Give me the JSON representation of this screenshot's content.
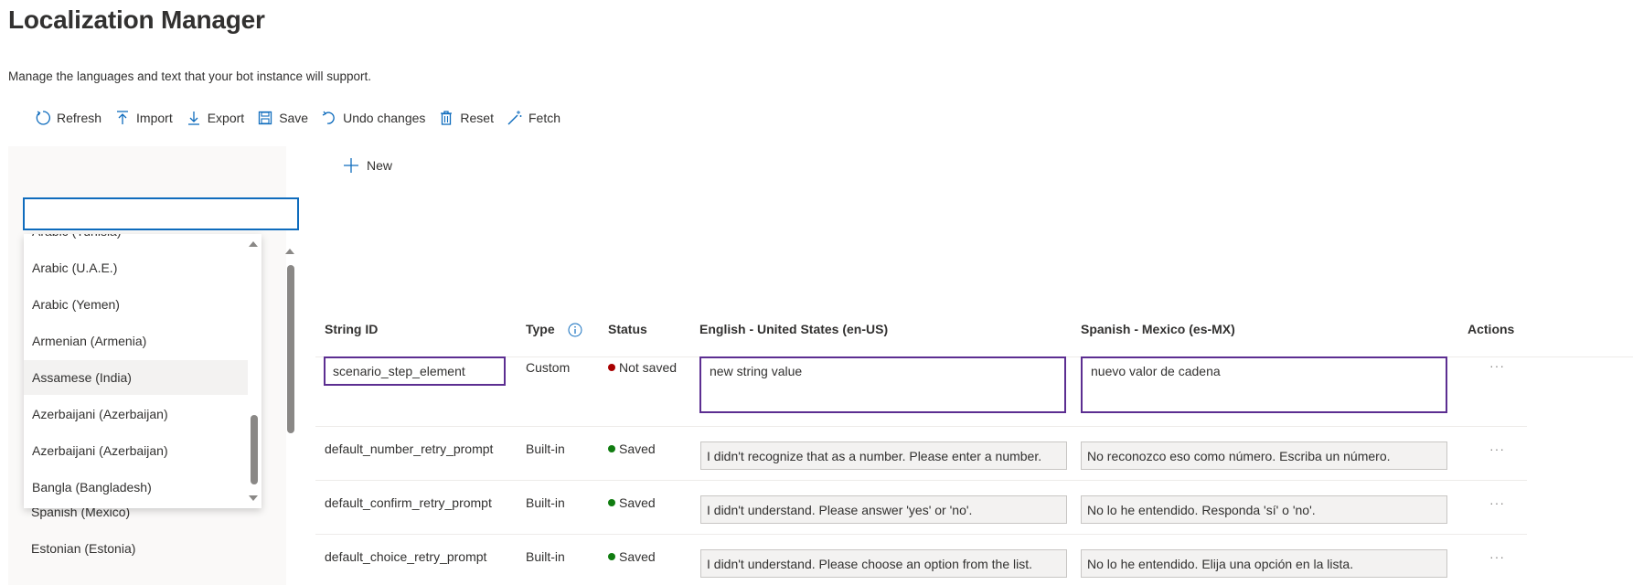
{
  "header": {
    "title": "Localization Manager",
    "subtitle": "Manage the languages and text that your bot instance will support."
  },
  "toolbar": {
    "refresh": "Refresh",
    "import": "Import",
    "export": "Export",
    "save": "Save",
    "undo": "Undo changes",
    "reset": "Reset",
    "fetch": "Fetch"
  },
  "sidebar": {
    "search_value": "",
    "dropdown_items": [
      "Arabic (Tunisia)",
      "Arabic (U.A.E.)",
      "Arabic (Yemen)",
      "Armenian (Armenia)",
      "Assamese (India)",
      "Azerbaijani (Azerbaijan)",
      "Azerbaijani (Azerbaijan)",
      "Bangla (Bangladesh)"
    ],
    "hovered_item": "Assamese (India)",
    "languages": [
      "Spanish (Mexico)",
      "Estonian (Estonia)"
    ]
  },
  "main": {
    "new_label": "New",
    "columns": {
      "string_id": "String ID",
      "type": "Type",
      "status": "Status",
      "english": "English - United States (en-US)",
      "spanish": "Spanish - Mexico (es-MX)",
      "actions": "Actions"
    },
    "rows": [
      {
        "id": "scenario_step_element",
        "type": "Custom",
        "status": "Not saved",
        "english": "new string value",
        "spanish": "nuevo valor de cadena",
        "actions": "···"
      },
      {
        "id": "default_number_retry_prompt",
        "type": "Built-in",
        "status": "Saved",
        "english": "I didn't recognize that as a number. Please enter a number.",
        "spanish": "No reconozco eso como número. Escriba un número.",
        "actions": "···"
      },
      {
        "id": "default_confirm_retry_prompt",
        "type": "Built-in",
        "status": "Saved",
        "english": "I didn't understand. Please answer 'yes' or 'no'.",
        "spanish": "No lo he entendido. Responda 'sí' o 'no'.",
        "actions": "···"
      },
      {
        "id": "default_choice_retry_prompt",
        "type": "Built-in",
        "status": "Saved",
        "english": "I didn't understand. Please choose an option from the list.",
        "spanish": "No lo he entendido. Elija una opción en la lista.",
        "actions": "···"
      }
    ]
  },
  "colors": {
    "accent": "#0f6cbd",
    "edit_border": "#5c2e91",
    "status_not_saved": "#a80000",
    "status_saved": "#107c10"
  }
}
